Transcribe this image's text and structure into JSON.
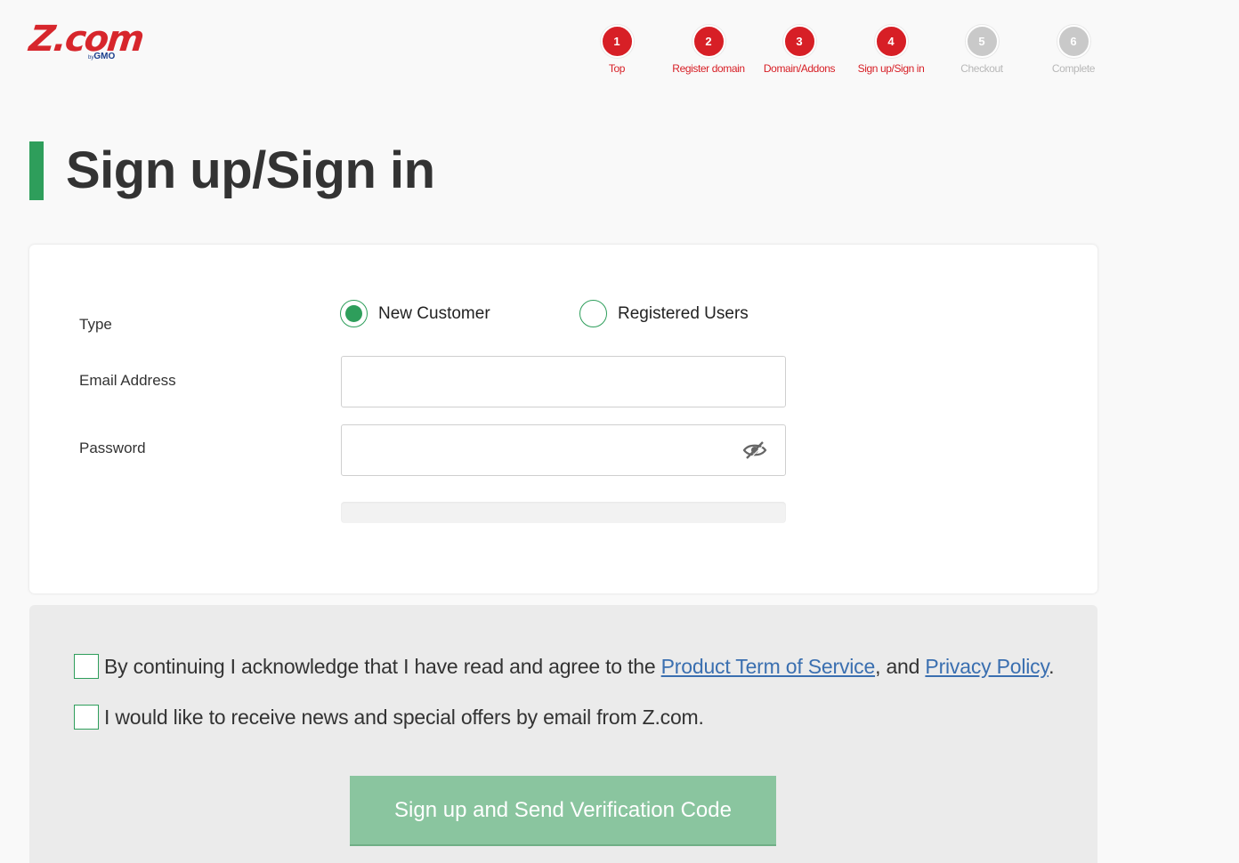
{
  "header": {
    "logo_text": "Z.com",
    "logo_sub_by": "by",
    "logo_sub_brand": "GMO",
    "brand_color": "#d71f26"
  },
  "steps": [
    {
      "number": "1",
      "label": "Top",
      "state": "done"
    },
    {
      "number": "2",
      "label": "Register domain",
      "state": "done"
    },
    {
      "number": "3",
      "label": "Domain/Addons",
      "state": "done"
    },
    {
      "number": "4",
      "label": "Sign up/Sign in",
      "state": "current"
    },
    {
      "number": "5",
      "label": "Checkout",
      "state": "inactive"
    },
    {
      "number": "6",
      "label": "Complete",
      "state": "inactive"
    }
  ],
  "page": {
    "title": "Sign up/Sign in",
    "accent_color": "#2e9e5b"
  },
  "form": {
    "type_label": "Type",
    "type_options": [
      {
        "label": "New Customer",
        "selected": true
      },
      {
        "label": "Registered Users",
        "selected": false
      }
    ],
    "email_label": "Email Address",
    "email_value": "",
    "email_placeholder": "",
    "password_label": "Password",
    "password_value": "",
    "password_placeholder": "",
    "password_toggle_icon": "eye-slash-icon"
  },
  "consent": {
    "terms_prefix": "By continuing I acknowledge that I have read and agree to the ",
    "terms_link": "Product Term of Service",
    "terms_middle": ", and ",
    "privacy_link": "Privacy Policy",
    "terms_suffix": ".",
    "terms_checked": false,
    "newsletter_text": "I would like to receive news and special offers by email from Z.com.",
    "newsletter_checked": false,
    "submit_label": "Sign up and Send Verification Code"
  }
}
